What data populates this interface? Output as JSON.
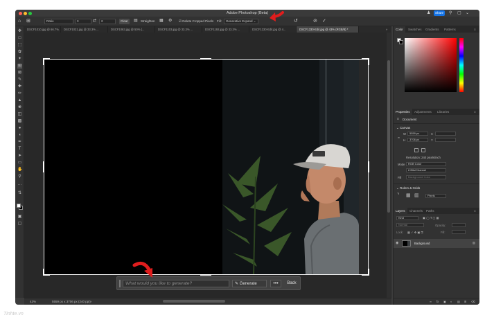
{
  "app": {
    "title": "Adobe Photoshop (Beta)",
    "share_label": "Share"
  },
  "options_bar": {
    "ratio": "Ratio",
    "ratio_w": "3",
    "ratio_h": "2",
    "clear": "Clear",
    "straighten": "Straighten",
    "delete_cropped": "Delete Cropped Pixels",
    "fill_label": "Fill:",
    "fill_value": "Generative Expand"
  },
  "doc_tabs": [
    {
      "label": "DSCF1010.jpg @ 66.7% ..."
    },
    {
      "label": "DSCF1021.jpg @ 33.3% ..."
    },
    {
      "label": "DSCF1063.jpg @ 50% (..."
    },
    {
      "label": "DSCF1103.jpg @ 33.3% ..."
    },
    {
      "label": "DSCF1192.jpg @ 33.3% ..."
    },
    {
      "label": "DSCF1330-Edit.jpg @ 4..."
    },
    {
      "label": "DSCF1330-Edit.jpg @ 43% (RGB/8) *"
    }
  ],
  "generate_bar": {
    "placeholder": "What would you like to generate?",
    "generate": "Generate",
    "more": "•••",
    "back": "Back"
  },
  "status": {
    "zoom": "43%",
    "dimensions": "5559 px x 3706 px (240 ppi)"
  },
  "color_panel": {
    "tabs": [
      "Color",
      "Swatches",
      "Gradients",
      "Patterns"
    ]
  },
  "properties_panel": {
    "tabs": [
      "Properties",
      "Adjustments",
      "Libraries"
    ],
    "document": "Document",
    "canvas_title": "Canvas",
    "w_label": "W",
    "w_value": "5559 px",
    "h_label": "H",
    "h_value": "3706 px",
    "x_label": "X",
    "y_label": "Y",
    "resolution": "Resolution: 240 pixels/inch",
    "mode_label": "Mode",
    "mode_value": "RGB Color",
    "depth_value": "8 Bits/Channel",
    "fill_label": "Fill",
    "fill_value": "Background Color",
    "rulers_title": "Rulers & Grids",
    "units_value": "Pixels"
  },
  "layers_panel": {
    "tabs": [
      "Layers",
      "Channels",
      "Paths"
    ],
    "kind": "Kind",
    "normal": "Normal",
    "opacity": "Opacity:",
    "lock": "Lock:",
    "fill": "Fill:",
    "layer_name": "Background"
  },
  "watermark": "Tinhte.vn"
}
